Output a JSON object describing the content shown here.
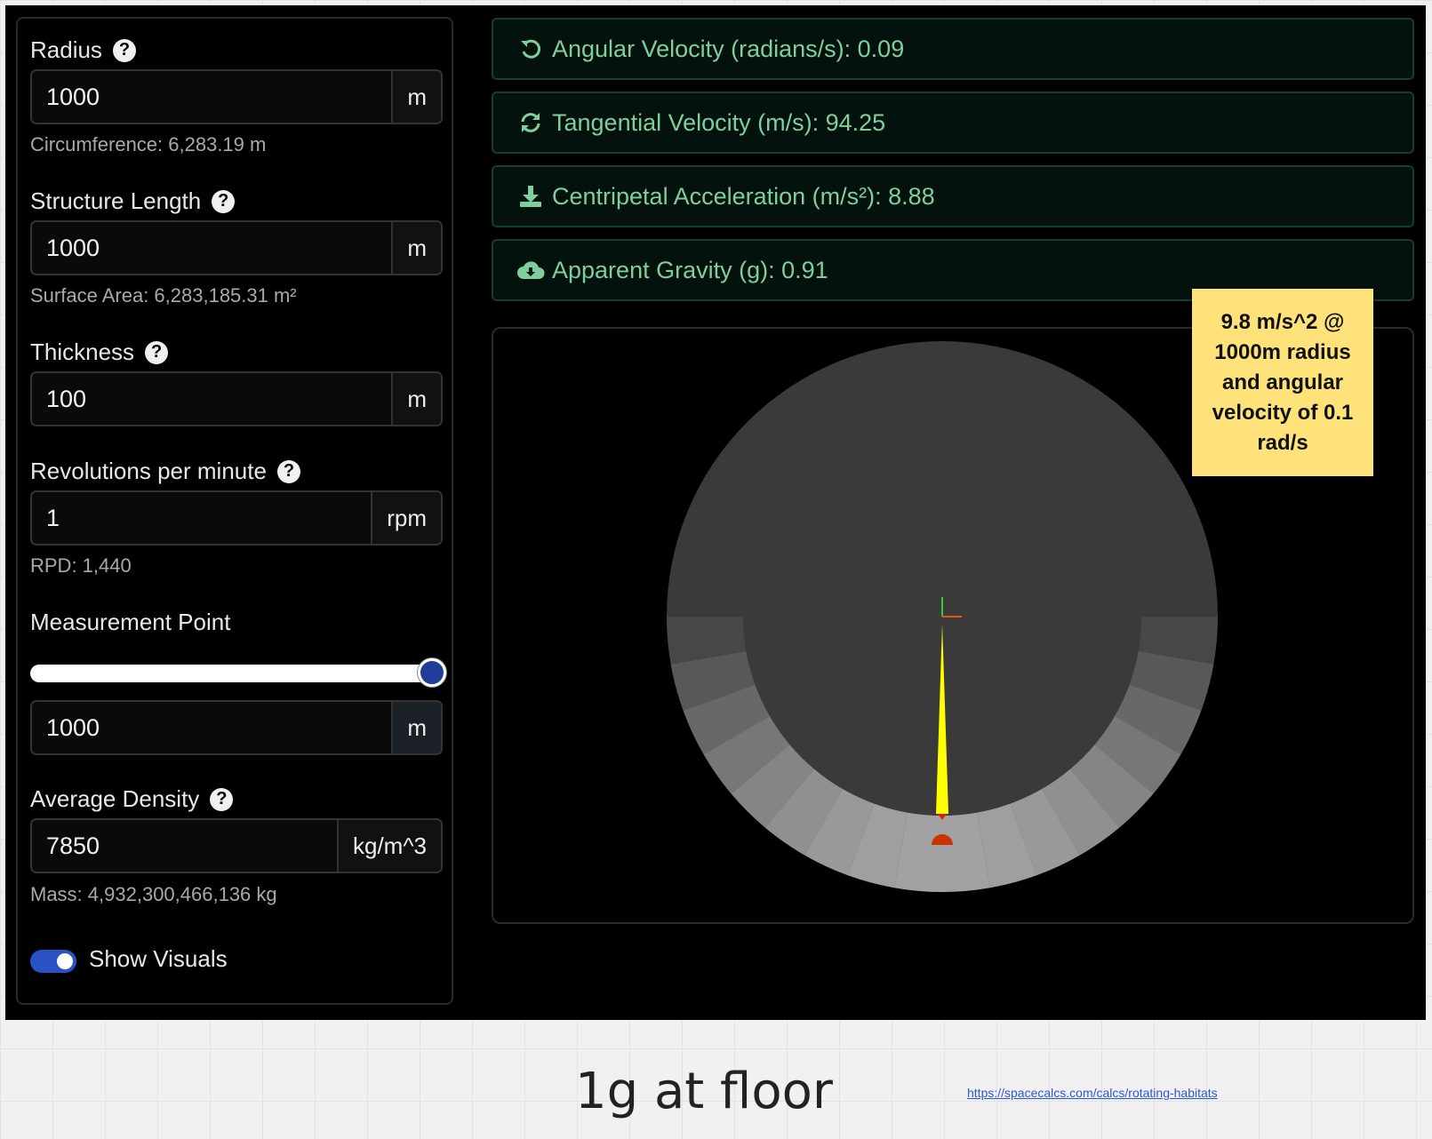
{
  "inputs": {
    "radius": {
      "label": "Radius",
      "value": "1000",
      "unit": "m",
      "sub": "Circumference: 6,283.19 m"
    },
    "length": {
      "label": "Structure Length",
      "value": "1000",
      "unit": "m",
      "sub": "Surface Area: 6,283,185.31 m²"
    },
    "thickness": {
      "label": "Thickness",
      "value": "100",
      "unit": "m"
    },
    "rpm": {
      "label": "Revolutions per minute",
      "value": "1",
      "unit": "rpm",
      "sub": "RPD: 1,440"
    },
    "measurement": {
      "label": "Measurement Point",
      "value": "1000",
      "unit": "m",
      "slider_fraction": 1.0
    },
    "density": {
      "label": "Average Density",
      "value": "7850",
      "unit": "kg/m^3",
      "sub": "Mass: 4,932,300,466,136 kg"
    },
    "help_glyph": "?"
  },
  "toggle": {
    "label": "Show Visuals",
    "on": true
  },
  "results": [
    {
      "icon": "undo-arrow-icon",
      "text": "Angular Velocity (radians/s): 0.09"
    },
    {
      "icon": "sync-arrows-icon",
      "text": "Tangential Velocity (m/s): 94.25"
    },
    {
      "icon": "download-icon",
      "text": "Centripetal Acceleration (m/s²): 8.88"
    },
    {
      "icon": "cloud-download-icon",
      "text": "Apparent Gravity (g): 0.91"
    }
  ],
  "sticky_note": "9.8 m/s^2 @ 1000m radius and angular velocity of 0.1 rad/s",
  "caption": "1g at floor",
  "link": "https://spacecalcs.com/calcs/rotating-habitats",
  "colors": {
    "accent": "#7fcf9e",
    "toggle": "#2a52c4",
    "sticky": "#ffe27a",
    "gravity_vector": "#ffff00",
    "marker": "#cc3300"
  }
}
